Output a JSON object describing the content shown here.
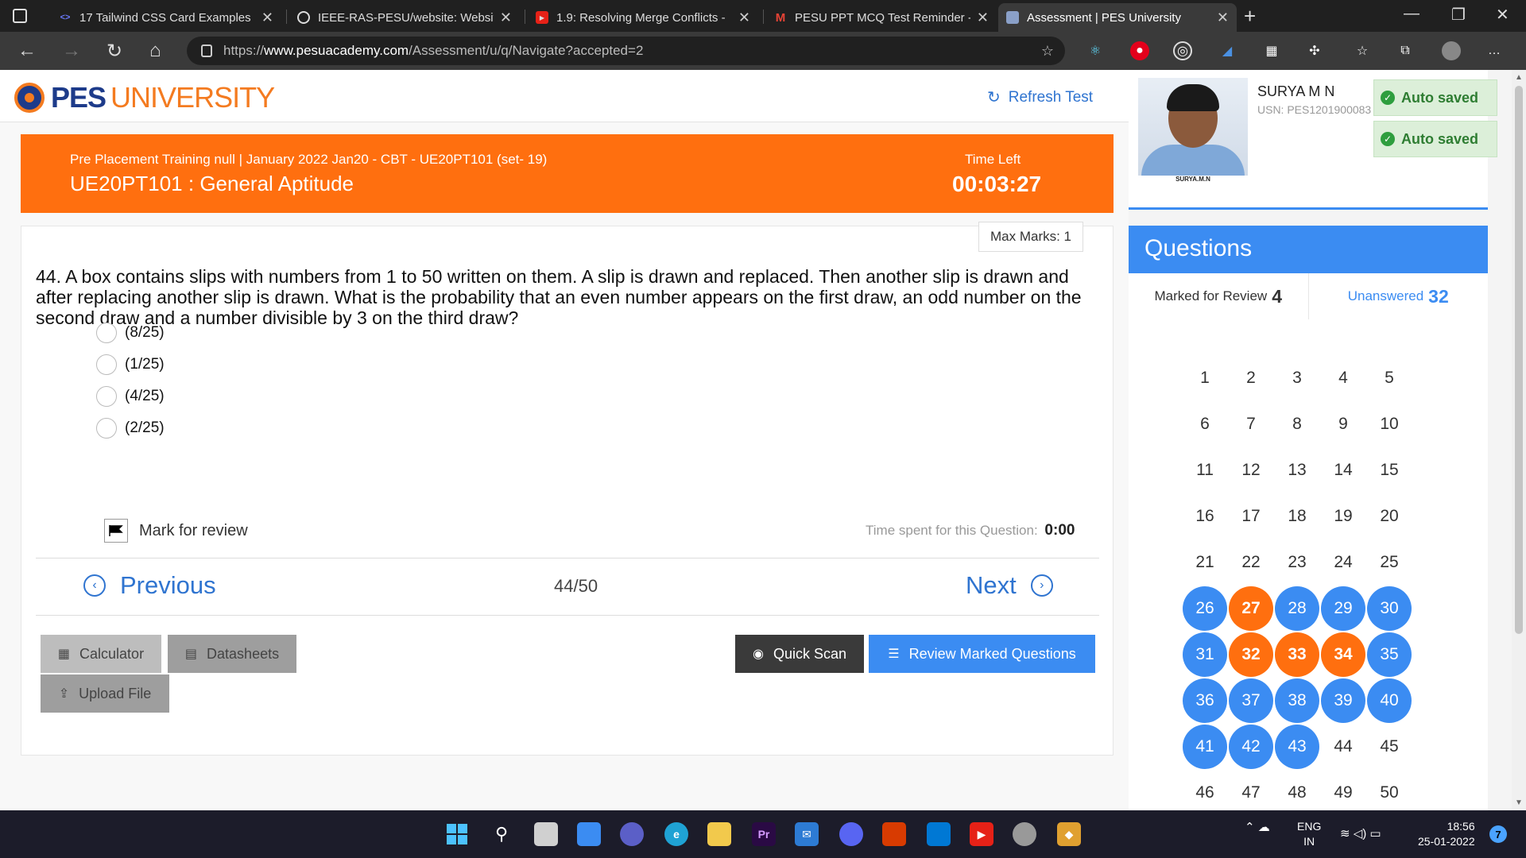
{
  "browser": {
    "tabs": [
      {
        "title": "17 Tailwind CSS Card Examples",
        "icon": "code-icon"
      },
      {
        "title": "IEEE-RAS-PESU/website: Website",
        "icon": "github-icon"
      },
      {
        "title": "1.9: Resolving Merge Conflicts -",
        "icon": "youtube-icon"
      },
      {
        "title": "PESU PPT MCQ Test Reminder -",
        "icon": "gmail-icon"
      },
      {
        "title": "Assessment | PES University",
        "icon": "page-icon"
      }
    ],
    "url_prefix": "https://",
    "url_domain": "www.pesuacademy.com",
    "url_path": "/Assessment/u/q/Navigate?accepted=2"
  },
  "header": {
    "logo_pes": "PES",
    "logo_university": "UNIVERSITY",
    "refresh_label": "Refresh Test"
  },
  "banner": {
    "subtitle": "Pre Placement Training null | January 2022 Jan20 - CBT - UE20PT101 (set- 19)",
    "course": "UE20PT101 : General Aptitude",
    "time_left_label": "Time Left",
    "time_left": "00:03:27"
  },
  "question": {
    "max_marks": "Max Marks: 1",
    "text": "44. A box contains slips with numbers from 1 to 50 written on them. A slip is drawn and replaced. Then another slip is drawn and after replacing another slip is drawn. What is the probability that an even number appears on the first draw, an odd number on the second draw and a number divisible by 3 on the third draw?",
    "options": [
      "(8/25)",
      "(1/25)",
      "(4/25)",
      "(2/25)"
    ],
    "mark_for_review": "Mark for review",
    "time_spent_label": "Time spent for this Question:",
    "time_spent": "0:00",
    "previous": "Previous",
    "next": "Next",
    "position": "44/50"
  },
  "buttons": {
    "calculator": "Calculator",
    "datasheets": "Datasheets",
    "upload": "Upload File",
    "quick_scan": "Quick Scan",
    "review_marked": "Review Marked Questions"
  },
  "profile": {
    "name": "SURYA M N",
    "usn": "USN: PES1201900083",
    "photo_caption": "SURYA.M.N",
    "auto_saved_1": "Auto saved",
    "auto_saved_2": "Auto saved"
  },
  "questions_panel": {
    "title": "Questions",
    "marked_label": "Marked for Review",
    "marked_count": "4",
    "unanswered_label": "Unanswered",
    "unanswered_count": "32",
    "answered": [
      26,
      28,
      29,
      30,
      31,
      35,
      36,
      37,
      38,
      39,
      40,
      41,
      42,
      43
    ],
    "marked": [
      27,
      32,
      33,
      34
    ],
    "total": 50
  },
  "taskbar": {
    "lang_1": "ENG",
    "lang_2": "IN",
    "time": "18:56",
    "date": "25-01-2022",
    "notifications": "7"
  },
  "colors": {
    "orange": "#ff6f0f",
    "blue": "#3b8cf2",
    "link_blue": "#2f74d0",
    "saved_green": "#2e7d32"
  }
}
